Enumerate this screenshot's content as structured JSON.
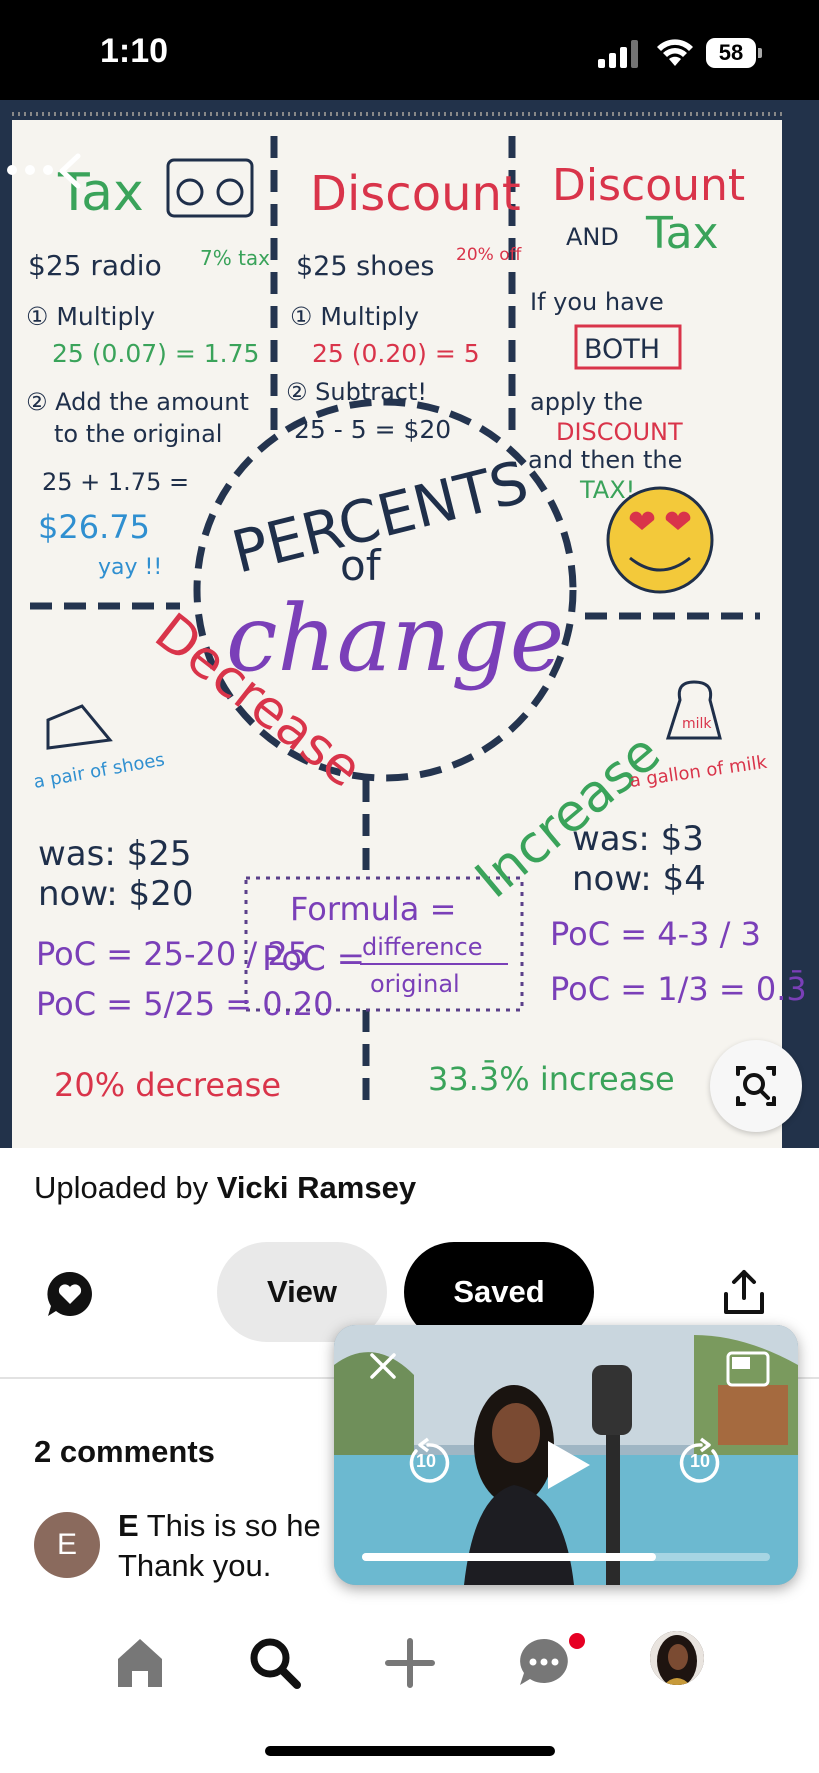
{
  "status_bar": {
    "time": "1:10",
    "battery": "58"
  },
  "pin": {
    "poster": {
      "center_title_top": "PERCENTS",
      "center_title_mid": "of",
      "center_title_main": "change",
      "tax": {
        "heading": "Tax",
        "line1": "$25 radio",
        "tag": "7% tax",
        "step1": "① Multiply",
        "calc1": "25 (0.07) = 1.75",
        "step2": "② Add the amount",
        "step2b": "to the original",
        "calc2": "25 + 1.75 =",
        "result": "$26.75",
        "yay": "yay !!"
      },
      "discount": {
        "heading": "Discount",
        "line1": "$25 shoes",
        "tag": "20% off",
        "step1": "① Multiply",
        "calc1": "25 (0.20) = 5",
        "step2": "② Subtract!",
        "calc2": "25 - 5 = $20"
      },
      "discount_tax": {
        "heading1": "Discount",
        "and": "AND",
        "heading2": "Tax",
        "line1": "If you have",
        "both": "BOTH",
        "line2": "apply the",
        "discount_word": "DISCOUNT",
        "line3": "and then the",
        "tax_word": "TAX!"
      },
      "decrease": {
        "word": "Decrease",
        "item": "a pair of shoes",
        "was": "was: $25",
        "now": "now: $20",
        "poc1": "PoC = 25-20 / 25",
        "poc2": "PoC = 5/25 = 0.20",
        "result": "20% decrease"
      },
      "increase": {
        "word": "Increase",
        "item": "a gallon of milk",
        "was": "was: $3",
        "now": "now: $4",
        "poc1": "PoC = 4-3 / 3",
        "poc2": "PoC = 1/3 = 0.3̄",
        "result": "33.3̄% increase"
      },
      "formula": {
        "title": "Formula =",
        "poc": "PoC =",
        "numerator": "difference",
        "denominator": "original"
      },
      "milk_label": "milk"
    }
  },
  "uploaded": {
    "prefix": "Uploaded by",
    "name": "Vicki Ramsey"
  },
  "actions": {
    "view_label": "View",
    "saved_label": "Saved"
  },
  "comments": {
    "title": "2 comments",
    "first": {
      "initial": "E",
      "author": "E",
      "text": "This is so he",
      "text2": "Thank you."
    }
  },
  "video": {
    "rewind_label": "10",
    "forward_label": "10",
    "progress": 0.72
  },
  "colors": {
    "accent": "#e60023",
    "saved_bg": "#000000",
    "view_bg": "#e9e9e9"
  }
}
